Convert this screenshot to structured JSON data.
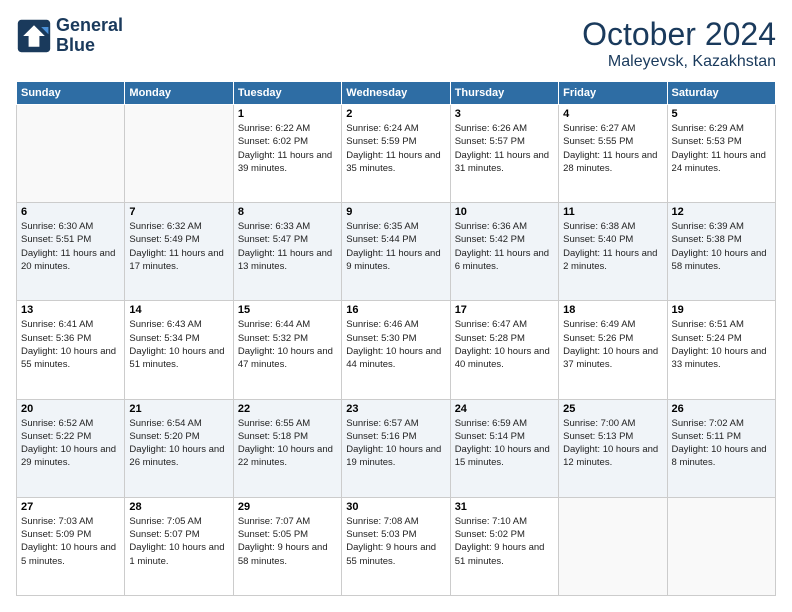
{
  "logo": {
    "line1": "General",
    "line2": "Blue"
  },
  "title": "October 2024",
  "location": "Maleyevsk, Kazakhstan",
  "days_of_week": [
    "Sunday",
    "Monday",
    "Tuesday",
    "Wednesday",
    "Thursday",
    "Friday",
    "Saturday"
  ],
  "weeks": [
    [
      {
        "num": "",
        "sunrise": "",
        "sunset": "",
        "daylight": "",
        "empty": true
      },
      {
        "num": "",
        "sunrise": "",
        "sunset": "",
        "daylight": "",
        "empty": true
      },
      {
        "num": "1",
        "sunrise": "Sunrise: 6:22 AM",
        "sunset": "Sunset: 6:02 PM",
        "daylight": "Daylight: 11 hours and 39 minutes."
      },
      {
        "num": "2",
        "sunrise": "Sunrise: 6:24 AM",
        "sunset": "Sunset: 5:59 PM",
        "daylight": "Daylight: 11 hours and 35 minutes."
      },
      {
        "num": "3",
        "sunrise": "Sunrise: 6:26 AM",
        "sunset": "Sunset: 5:57 PM",
        "daylight": "Daylight: 11 hours and 31 minutes."
      },
      {
        "num": "4",
        "sunrise": "Sunrise: 6:27 AM",
        "sunset": "Sunset: 5:55 PM",
        "daylight": "Daylight: 11 hours and 28 minutes."
      },
      {
        "num": "5",
        "sunrise": "Sunrise: 6:29 AM",
        "sunset": "Sunset: 5:53 PM",
        "daylight": "Daylight: 11 hours and 24 minutes."
      }
    ],
    [
      {
        "num": "6",
        "sunrise": "Sunrise: 6:30 AM",
        "sunset": "Sunset: 5:51 PM",
        "daylight": "Daylight: 11 hours and 20 minutes."
      },
      {
        "num": "7",
        "sunrise": "Sunrise: 6:32 AM",
        "sunset": "Sunset: 5:49 PM",
        "daylight": "Daylight: 11 hours and 17 minutes."
      },
      {
        "num": "8",
        "sunrise": "Sunrise: 6:33 AM",
        "sunset": "Sunset: 5:47 PM",
        "daylight": "Daylight: 11 hours and 13 minutes."
      },
      {
        "num": "9",
        "sunrise": "Sunrise: 6:35 AM",
        "sunset": "Sunset: 5:44 PM",
        "daylight": "Daylight: 11 hours and 9 minutes."
      },
      {
        "num": "10",
        "sunrise": "Sunrise: 6:36 AM",
        "sunset": "Sunset: 5:42 PM",
        "daylight": "Daylight: 11 hours and 6 minutes."
      },
      {
        "num": "11",
        "sunrise": "Sunrise: 6:38 AM",
        "sunset": "Sunset: 5:40 PM",
        "daylight": "Daylight: 11 hours and 2 minutes."
      },
      {
        "num": "12",
        "sunrise": "Sunrise: 6:39 AM",
        "sunset": "Sunset: 5:38 PM",
        "daylight": "Daylight: 10 hours and 58 minutes."
      }
    ],
    [
      {
        "num": "13",
        "sunrise": "Sunrise: 6:41 AM",
        "sunset": "Sunset: 5:36 PM",
        "daylight": "Daylight: 10 hours and 55 minutes."
      },
      {
        "num": "14",
        "sunrise": "Sunrise: 6:43 AM",
        "sunset": "Sunset: 5:34 PM",
        "daylight": "Daylight: 10 hours and 51 minutes."
      },
      {
        "num": "15",
        "sunrise": "Sunrise: 6:44 AM",
        "sunset": "Sunset: 5:32 PM",
        "daylight": "Daylight: 10 hours and 47 minutes."
      },
      {
        "num": "16",
        "sunrise": "Sunrise: 6:46 AM",
        "sunset": "Sunset: 5:30 PM",
        "daylight": "Daylight: 10 hours and 44 minutes."
      },
      {
        "num": "17",
        "sunrise": "Sunrise: 6:47 AM",
        "sunset": "Sunset: 5:28 PM",
        "daylight": "Daylight: 10 hours and 40 minutes."
      },
      {
        "num": "18",
        "sunrise": "Sunrise: 6:49 AM",
        "sunset": "Sunset: 5:26 PM",
        "daylight": "Daylight: 10 hours and 37 minutes."
      },
      {
        "num": "19",
        "sunrise": "Sunrise: 6:51 AM",
        "sunset": "Sunset: 5:24 PM",
        "daylight": "Daylight: 10 hours and 33 minutes."
      }
    ],
    [
      {
        "num": "20",
        "sunrise": "Sunrise: 6:52 AM",
        "sunset": "Sunset: 5:22 PM",
        "daylight": "Daylight: 10 hours and 29 minutes."
      },
      {
        "num": "21",
        "sunrise": "Sunrise: 6:54 AM",
        "sunset": "Sunset: 5:20 PM",
        "daylight": "Daylight: 10 hours and 26 minutes."
      },
      {
        "num": "22",
        "sunrise": "Sunrise: 6:55 AM",
        "sunset": "Sunset: 5:18 PM",
        "daylight": "Daylight: 10 hours and 22 minutes."
      },
      {
        "num": "23",
        "sunrise": "Sunrise: 6:57 AM",
        "sunset": "Sunset: 5:16 PM",
        "daylight": "Daylight: 10 hours and 19 minutes."
      },
      {
        "num": "24",
        "sunrise": "Sunrise: 6:59 AM",
        "sunset": "Sunset: 5:14 PM",
        "daylight": "Daylight: 10 hours and 15 minutes."
      },
      {
        "num": "25",
        "sunrise": "Sunrise: 7:00 AM",
        "sunset": "Sunset: 5:13 PM",
        "daylight": "Daylight: 10 hours and 12 minutes."
      },
      {
        "num": "26",
        "sunrise": "Sunrise: 7:02 AM",
        "sunset": "Sunset: 5:11 PM",
        "daylight": "Daylight: 10 hours and 8 minutes."
      }
    ],
    [
      {
        "num": "27",
        "sunrise": "Sunrise: 7:03 AM",
        "sunset": "Sunset: 5:09 PM",
        "daylight": "Daylight: 10 hours and 5 minutes."
      },
      {
        "num": "28",
        "sunrise": "Sunrise: 7:05 AM",
        "sunset": "Sunset: 5:07 PM",
        "daylight": "Daylight: 10 hours and 1 minute."
      },
      {
        "num": "29",
        "sunrise": "Sunrise: 7:07 AM",
        "sunset": "Sunset: 5:05 PM",
        "daylight": "Daylight: 9 hours and 58 minutes."
      },
      {
        "num": "30",
        "sunrise": "Sunrise: 7:08 AM",
        "sunset": "Sunset: 5:03 PM",
        "daylight": "Daylight: 9 hours and 55 minutes."
      },
      {
        "num": "31",
        "sunrise": "Sunrise: 7:10 AM",
        "sunset": "Sunset: 5:02 PM",
        "daylight": "Daylight: 9 hours and 51 minutes."
      },
      {
        "num": "",
        "sunrise": "",
        "sunset": "",
        "daylight": "",
        "empty": true
      },
      {
        "num": "",
        "sunrise": "",
        "sunset": "",
        "daylight": "",
        "empty": true
      }
    ]
  ]
}
